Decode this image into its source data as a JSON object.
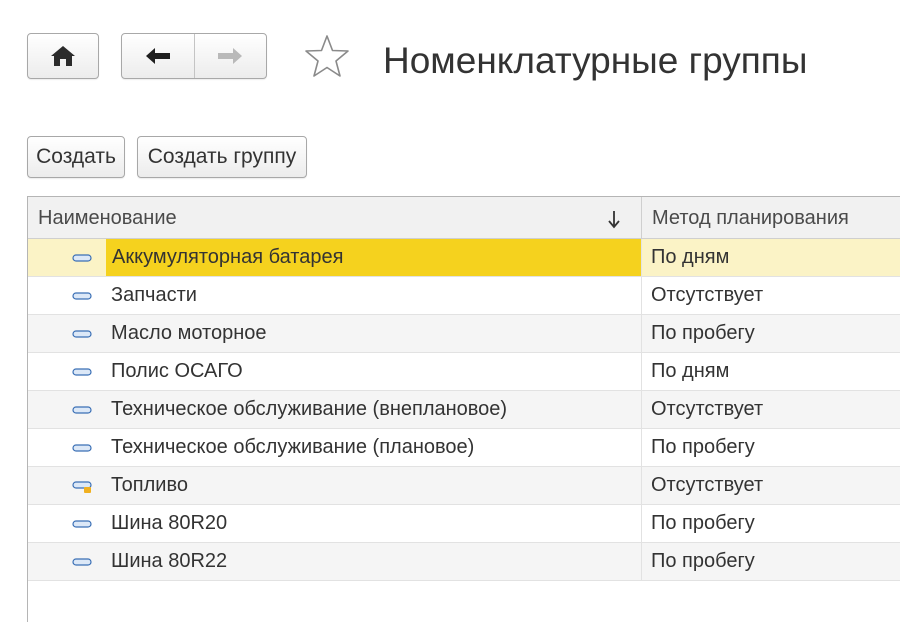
{
  "header": {
    "title": "Номенклатурные группы",
    "home_icon": "home-icon",
    "back_icon": "arrow-left-icon",
    "forward_icon": "arrow-right-icon",
    "favorite_icon": "star-icon"
  },
  "toolbar": {
    "create_label": "Создать",
    "create_group_label": "Создать группу"
  },
  "table": {
    "columns": [
      "Наименование",
      "Метод планирования"
    ],
    "sort_icon": "sort-down-arrow-icon",
    "rows": [
      {
        "name": "Аккумуляторная батарея",
        "method": "По дням",
        "selected": true,
        "icon": "item-icon"
      },
      {
        "name": "Запчасти",
        "method": "Отсутствует",
        "icon": "item-icon"
      },
      {
        "name": "Масло моторное",
        "method": "По пробегу",
        "icon": "item-icon"
      },
      {
        "name": "Полис ОСАГО",
        "method": "По дням",
        "icon": "item-icon"
      },
      {
        "name": "Техническое обслуживание (внеплановое)",
        "method": "Отсутствует",
        "icon": "item-icon"
      },
      {
        "name": "Техническое обслуживание (плановое)",
        "method": "По пробегу",
        "icon": "item-icon"
      },
      {
        "name": "Топливо",
        "method": "Отсутствует",
        "icon": "item-marked-icon"
      },
      {
        "name": "Шина 80R20",
        "method": "По пробегу",
        "icon": "item-icon"
      },
      {
        "name": "Шина 80R22",
        "method": "По пробегу",
        "icon": "item-icon"
      }
    ]
  },
  "colors": {
    "selection": "#f5d21e",
    "selected_row": "#fbf3c6",
    "item_icon": "#3a6fb5",
    "marker": "#f0b020"
  }
}
